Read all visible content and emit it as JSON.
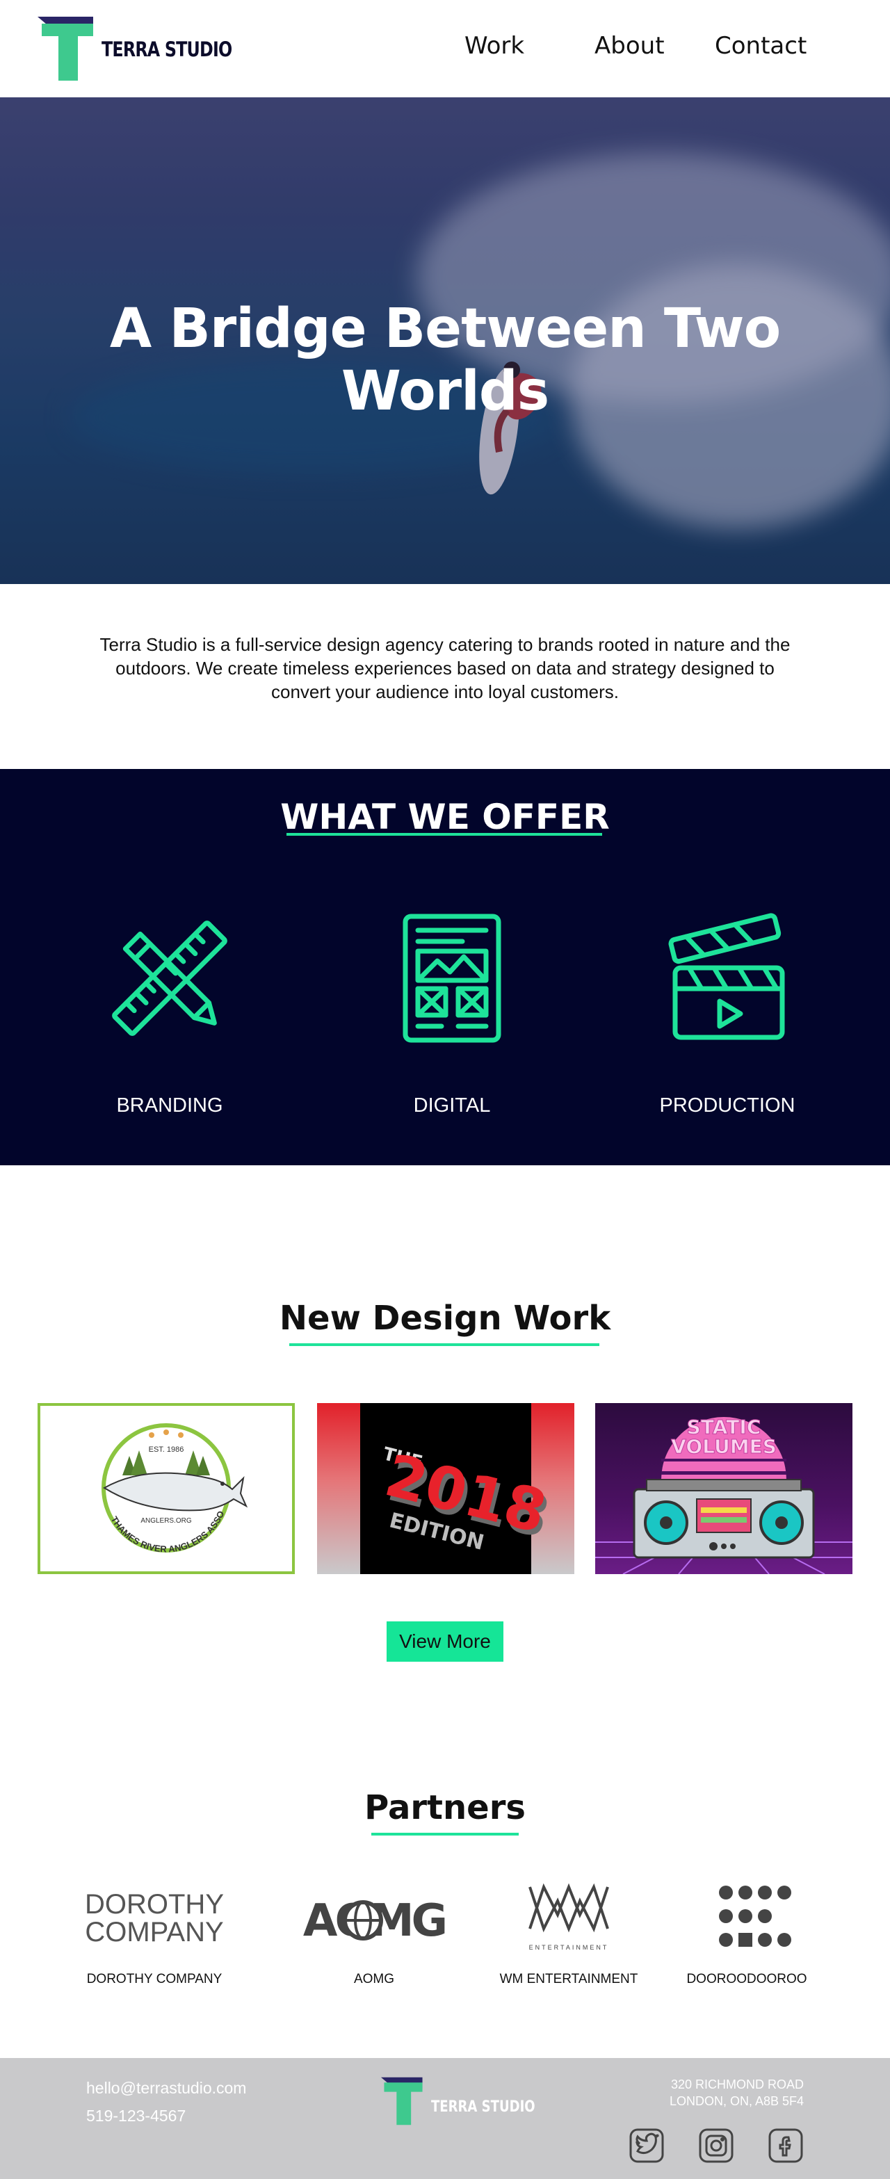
{
  "header": {
    "brand": "TERRA STUDIO",
    "nav": [
      "Work",
      "About",
      "Contact"
    ]
  },
  "hero": {
    "title": "A Bridge Between Two Worlds"
  },
  "intro": {
    "text": "Terra Studio is a full-service design agency catering to brands rooted in nature and the outdoors. We create timeless experiences based on data and strategy designed to convert your audience into loyal customers."
  },
  "offer": {
    "title": "WHAT WE OFFER",
    "items": [
      {
        "label": "BRANDING",
        "icon": "ruler-pencil-icon"
      },
      {
        "label": "DIGITAL",
        "icon": "wireframe-device-icon"
      },
      {
        "label": "PRODUCTION",
        "icon": "clapperboard-icon"
      }
    ]
  },
  "work": {
    "title": "New Design Work",
    "view_more": "View More",
    "thumbs": [
      {
        "name": "thames-river-anglers",
        "est": "EST. 1986",
        "url_text": "ANGLERS.ORG",
        "arc_text": "THAMES RIVER ANGLERS ASSOCIATION"
      },
      {
        "name": "the-2018-edition",
        "small": "THE",
        "big": "2018",
        "bottom": "EDITION"
      },
      {
        "name": "static-volumes",
        "line1": "STATIC",
        "line2": "VOLUMES"
      }
    ]
  },
  "partners": {
    "title": "Partners",
    "items": [
      {
        "caption": "DOROTHY COMPANY",
        "logo_line1": "DOROTHY",
        "logo_line2": "COMPANY"
      },
      {
        "caption": "AOMG",
        "logo_text": "AOMG"
      },
      {
        "caption": "WM ENTERTAINMENT",
        "logo_sub": "ENTERTAINMENT"
      },
      {
        "caption": "DOOROODOOROO"
      }
    ]
  },
  "footer": {
    "email": "hello@terrastudio.com",
    "phone": "519-123-4567",
    "brand": "TERRA STUDIO",
    "address_line1": "320 RICHMOND ROAD",
    "address_line2": "LONDON, ON, A8B 5F4",
    "social": [
      "twitter-icon",
      "instagram-icon",
      "facebook-icon"
    ]
  },
  "colors": {
    "accent": "#15e597",
    "navy": "#02052b",
    "footer": "#c9c9cb"
  }
}
